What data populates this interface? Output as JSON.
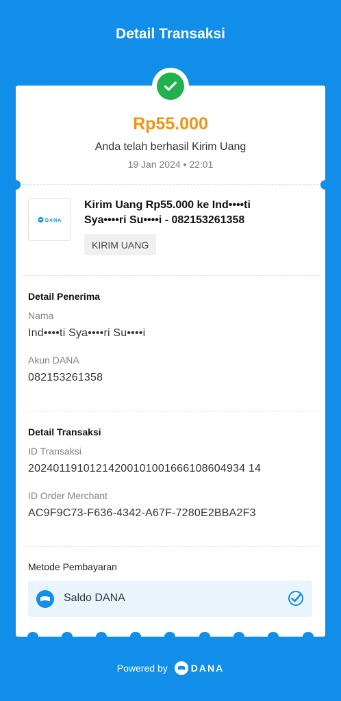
{
  "header": {
    "title": "Detail Transaksi"
  },
  "summary": {
    "amount": "Rp55.000",
    "status": "Anda telah berhasil Kirim Uang",
    "datetime": "19 Jan 2024 • 22:01"
  },
  "transaction": {
    "logo_text": "DANA",
    "title": "Kirim Uang Rp55.000 ke Ind••••ti Sya••••ri Su••••i - 082153261358",
    "tag": "KIRIM UANG"
  },
  "recipient": {
    "heading": "Detail Penerima",
    "name_label": "Nama",
    "name_value": "Ind••••ti Sya••••ri Su••••i",
    "account_label": "Akun DANA",
    "account_value": "082153261358"
  },
  "details": {
    "heading": "Detail Transaksi",
    "tx_id_label": "ID Transaksi",
    "tx_id_value": "20240119101214200101001666108604934 14",
    "order_id_label": "ID Order Merchant",
    "order_id_value": "AC9F9C73-F636-4342-A67F-7280E2BBA2F3"
  },
  "payment": {
    "heading": "Metode Pembayaran",
    "method": "Saldo DANA"
  },
  "footer": {
    "powered_by": "Powered by",
    "brand": "DANA"
  },
  "colors": {
    "primary": "#108ee9",
    "amount": "#f39314",
    "success": "#21b24d"
  },
  "icons": [
    "check-icon",
    "dana-logo",
    "wallet-icon",
    "selected-check-icon"
  ]
}
